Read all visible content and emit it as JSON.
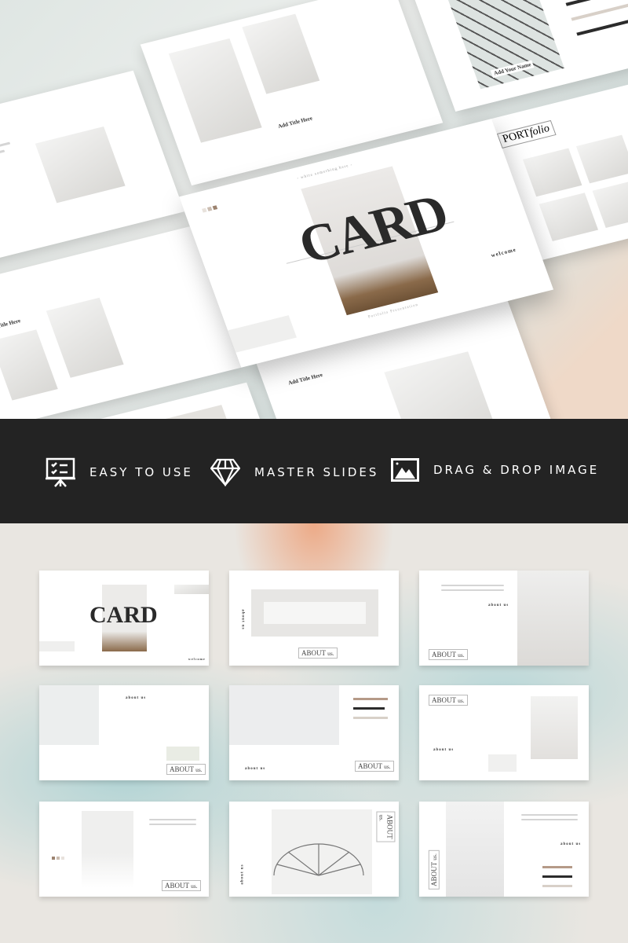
{
  "cover": {
    "title": "CARD",
    "tagline": "- white something here -",
    "subtitle": "Portfolio Presentation",
    "welcome": "welcome"
  },
  "collage": {
    "add_title": "Add Title Here",
    "add_name": "Add Your Name",
    "portfolio_a": "PORT",
    "portfolio_b": "folio",
    "team": "team"
  },
  "features": [
    {
      "icon": "presentation-board-icon",
      "label": "EASY TO USE"
    },
    {
      "icon": "diamond-icon",
      "label": "MASTER SLIDES"
    },
    {
      "icon": "image-icon",
      "label": "DRAG & DROP IMAGE"
    }
  ],
  "grid": {
    "about": "about us",
    "about_big": "ABOUT",
    "about_small": "us."
  },
  "colors": {
    "banner": "#232323",
    "accent_tan": "#b59a88",
    "accent_dark": "#2b2b2b",
    "accent_light": "#d8d0c8"
  }
}
